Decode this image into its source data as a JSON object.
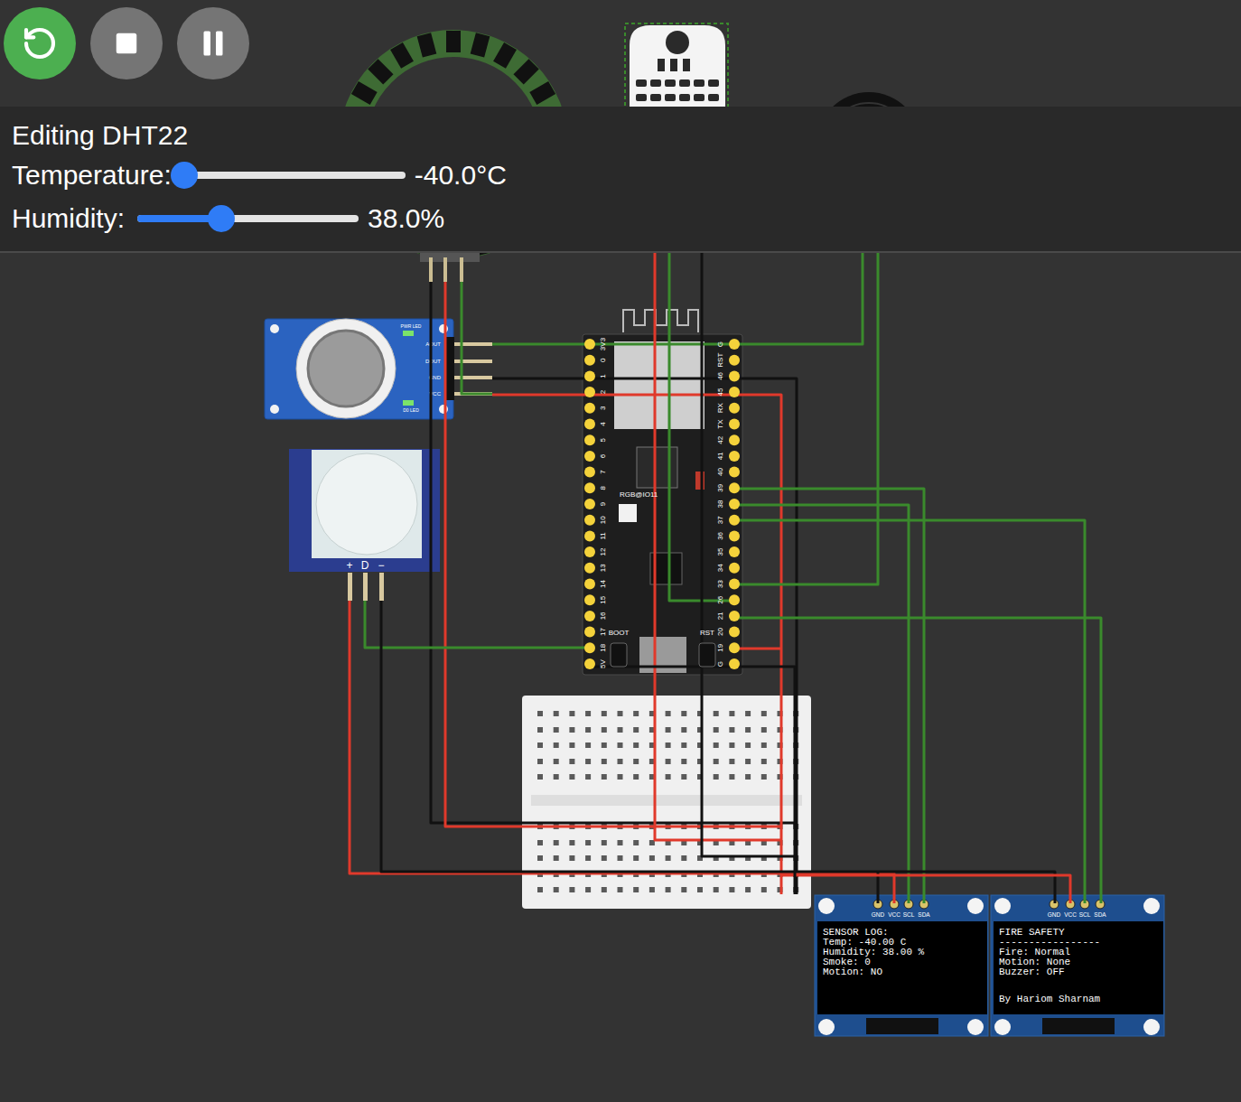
{
  "simulation": {
    "running": true
  },
  "editor": {
    "title": "Editing DHT22",
    "fields": [
      {
        "label": "Temperature:",
        "level": 0,
        "reading": "-40.0°C"
      },
      {
        "label": "Humidity:",
        "level": 0.38,
        "reading": "38.0%"
      }
    ]
  },
  "gas_sensor": {
    "leds": [
      {
        "label": "PWR LED",
        "on": true
      },
      {
        "label": "D0 LED",
        "on": true
      }
    ],
    "pins": [
      "AOUT",
      "DOUT",
      "GND",
      "VCC"
    ]
  },
  "motion_sensor": {
    "pins": [
      "+",
      "D",
      "−"
    ]
  },
  "board": {
    "left_pins": [
      "3V3",
      "0",
      "1",
      "2",
      "3",
      "4",
      "5",
      "6",
      "7",
      "8",
      "9",
      "10",
      "11",
      "12",
      "13",
      "14",
      "15",
      "16",
      "17",
      "18",
      "5V"
    ],
    "right_pins": [
      "G",
      "RST",
      "46",
      "45",
      "RX",
      "TX",
      "42",
      "41",
      "40",
      "39",
      "38",
      "37",
      "36",
      "35",
      "34",
      "33",
      "26",
      "21",
      "20",
      "19",
      "G"
    ],
    "rgb_label": "RGB@IO11",
    "buttons": [
      "BOOT",
      "RST"
    ]
  },
  "displays": [
    {
      "pins": [
        "GND",
        "VCC",
        "SCL",
        "SDA"
      ],
      "lines": [
        "SENSOR LOG:",
        "Temp: -40.00 C",
        "Humidity: 38.00 %",
        "Smoke: 0",
        "Motion: NO"
      ],
      "footer": ""
    },
    {
      "pins": [
        "GND",
        "VCC",
        "SCL",
        "SDA"
      ],
      "lines": [
        "FIRE SAFETY",
        "-----------------",
        "Fire: Normal",
        "Motion: None",
        "Buzzer: OFF"
      ],
      "footer": "By Hariom Sharnam"
    }
  ],
  "wires": [
    {
      "color": "#111111"
    },
    {
      "color": "#e0392b"
    },
    {
      "color": "#3a8a2c"
    },
    {
      "color": "#3a8a2c"
    },
    {
      "color": "#111111"
    },
    {
      "color": "#e0392b"
    },
    {
      "color": "#e0392b"
    },
    {
      "color": "#3a8a2c"
    },
    {
      "color": "#111111"
    },
    {
      "color": "#3a8a2c"
    },
    {
      "color": "#3a8a2c"
    },
    {
      "color": "#3a8a2c"
    },
    {
      "color": "#3a8a2c"
    },
    {
      "color": "#3a8a2c"
    },
    {
      "color": "#3a8a2c"
    },
    {
      "color": "#e0392b"
    },
    {
      "color": "#e0392b"
    },
    {
      "color": "#111111"
    },
    {
      "color": "#111111"
    },
    {
      "color": "#e0392b"
    },
    {
      "color": "#111111"
    }
  ]
}
